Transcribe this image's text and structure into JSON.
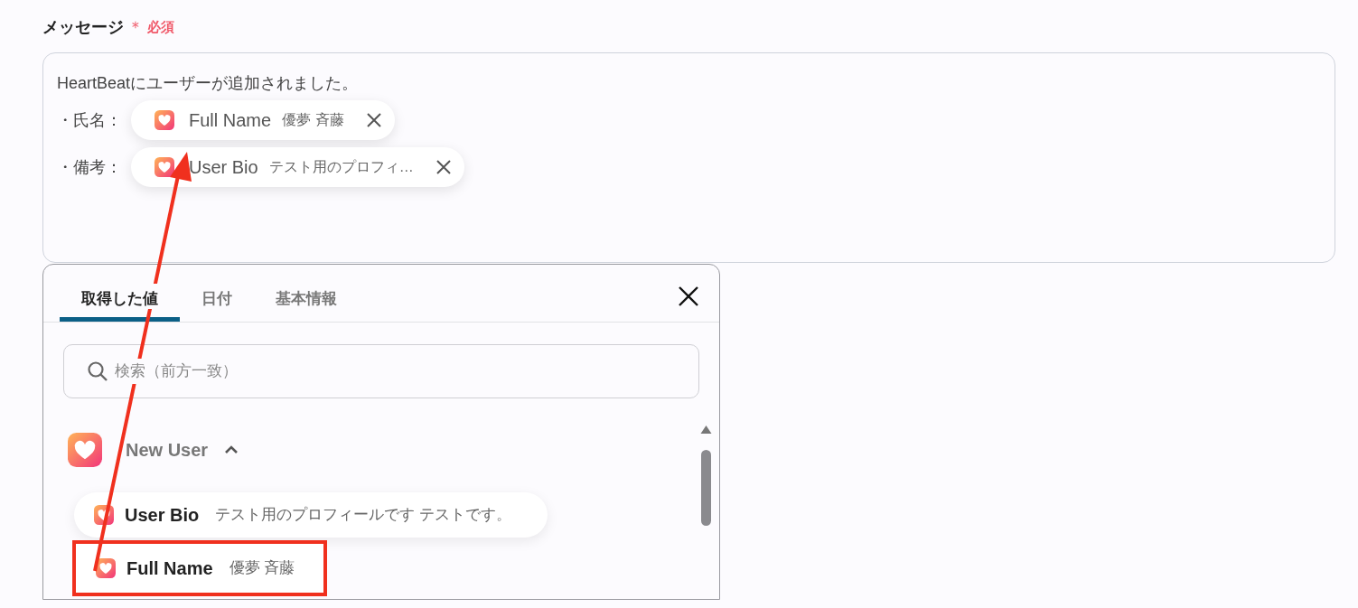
{
  "field": {
    "label": "メッセージ",
    "required_mark": "＊",
    "required_text": "必須"
  },
  "message": {
    "first_line": "HeartBeatにユーザーが追加されました。",
    "rows": [
      {
        "prefix": "・氏名：",
        "chip": {
          "label": "Full Name",
          "value": "優夢 斉藤"
        }
      },
      {
        "prefix": "・備考：",
        "chip": {
          "label": "User Bio",
          "value": "テスト用のプロフィ…"
        }
      }
    ]
  },
  "picker": {
    "tabs": [
      {
        "label": "取得した値",
        "selected": true
      },
      {
        "label": "日付",
        "selected": false
      },
      {
        "label": "基本情報",
        "selected": false
      }
    ],
    "search": {
      "placeholder": "検索（前方一致）"
    },
    "group": {
      "name": "New User",
      "expanded": true
    },
    "items": [
      {
        "label": "User Bio",
        "value": "テスト用のプロフィールです テストです。",
        "highlighted": false
      },
      {
        "label": "Full Name",
        "value": "優夢 斉藤",
        "highlighted": true
      }
    ]
  }
}
